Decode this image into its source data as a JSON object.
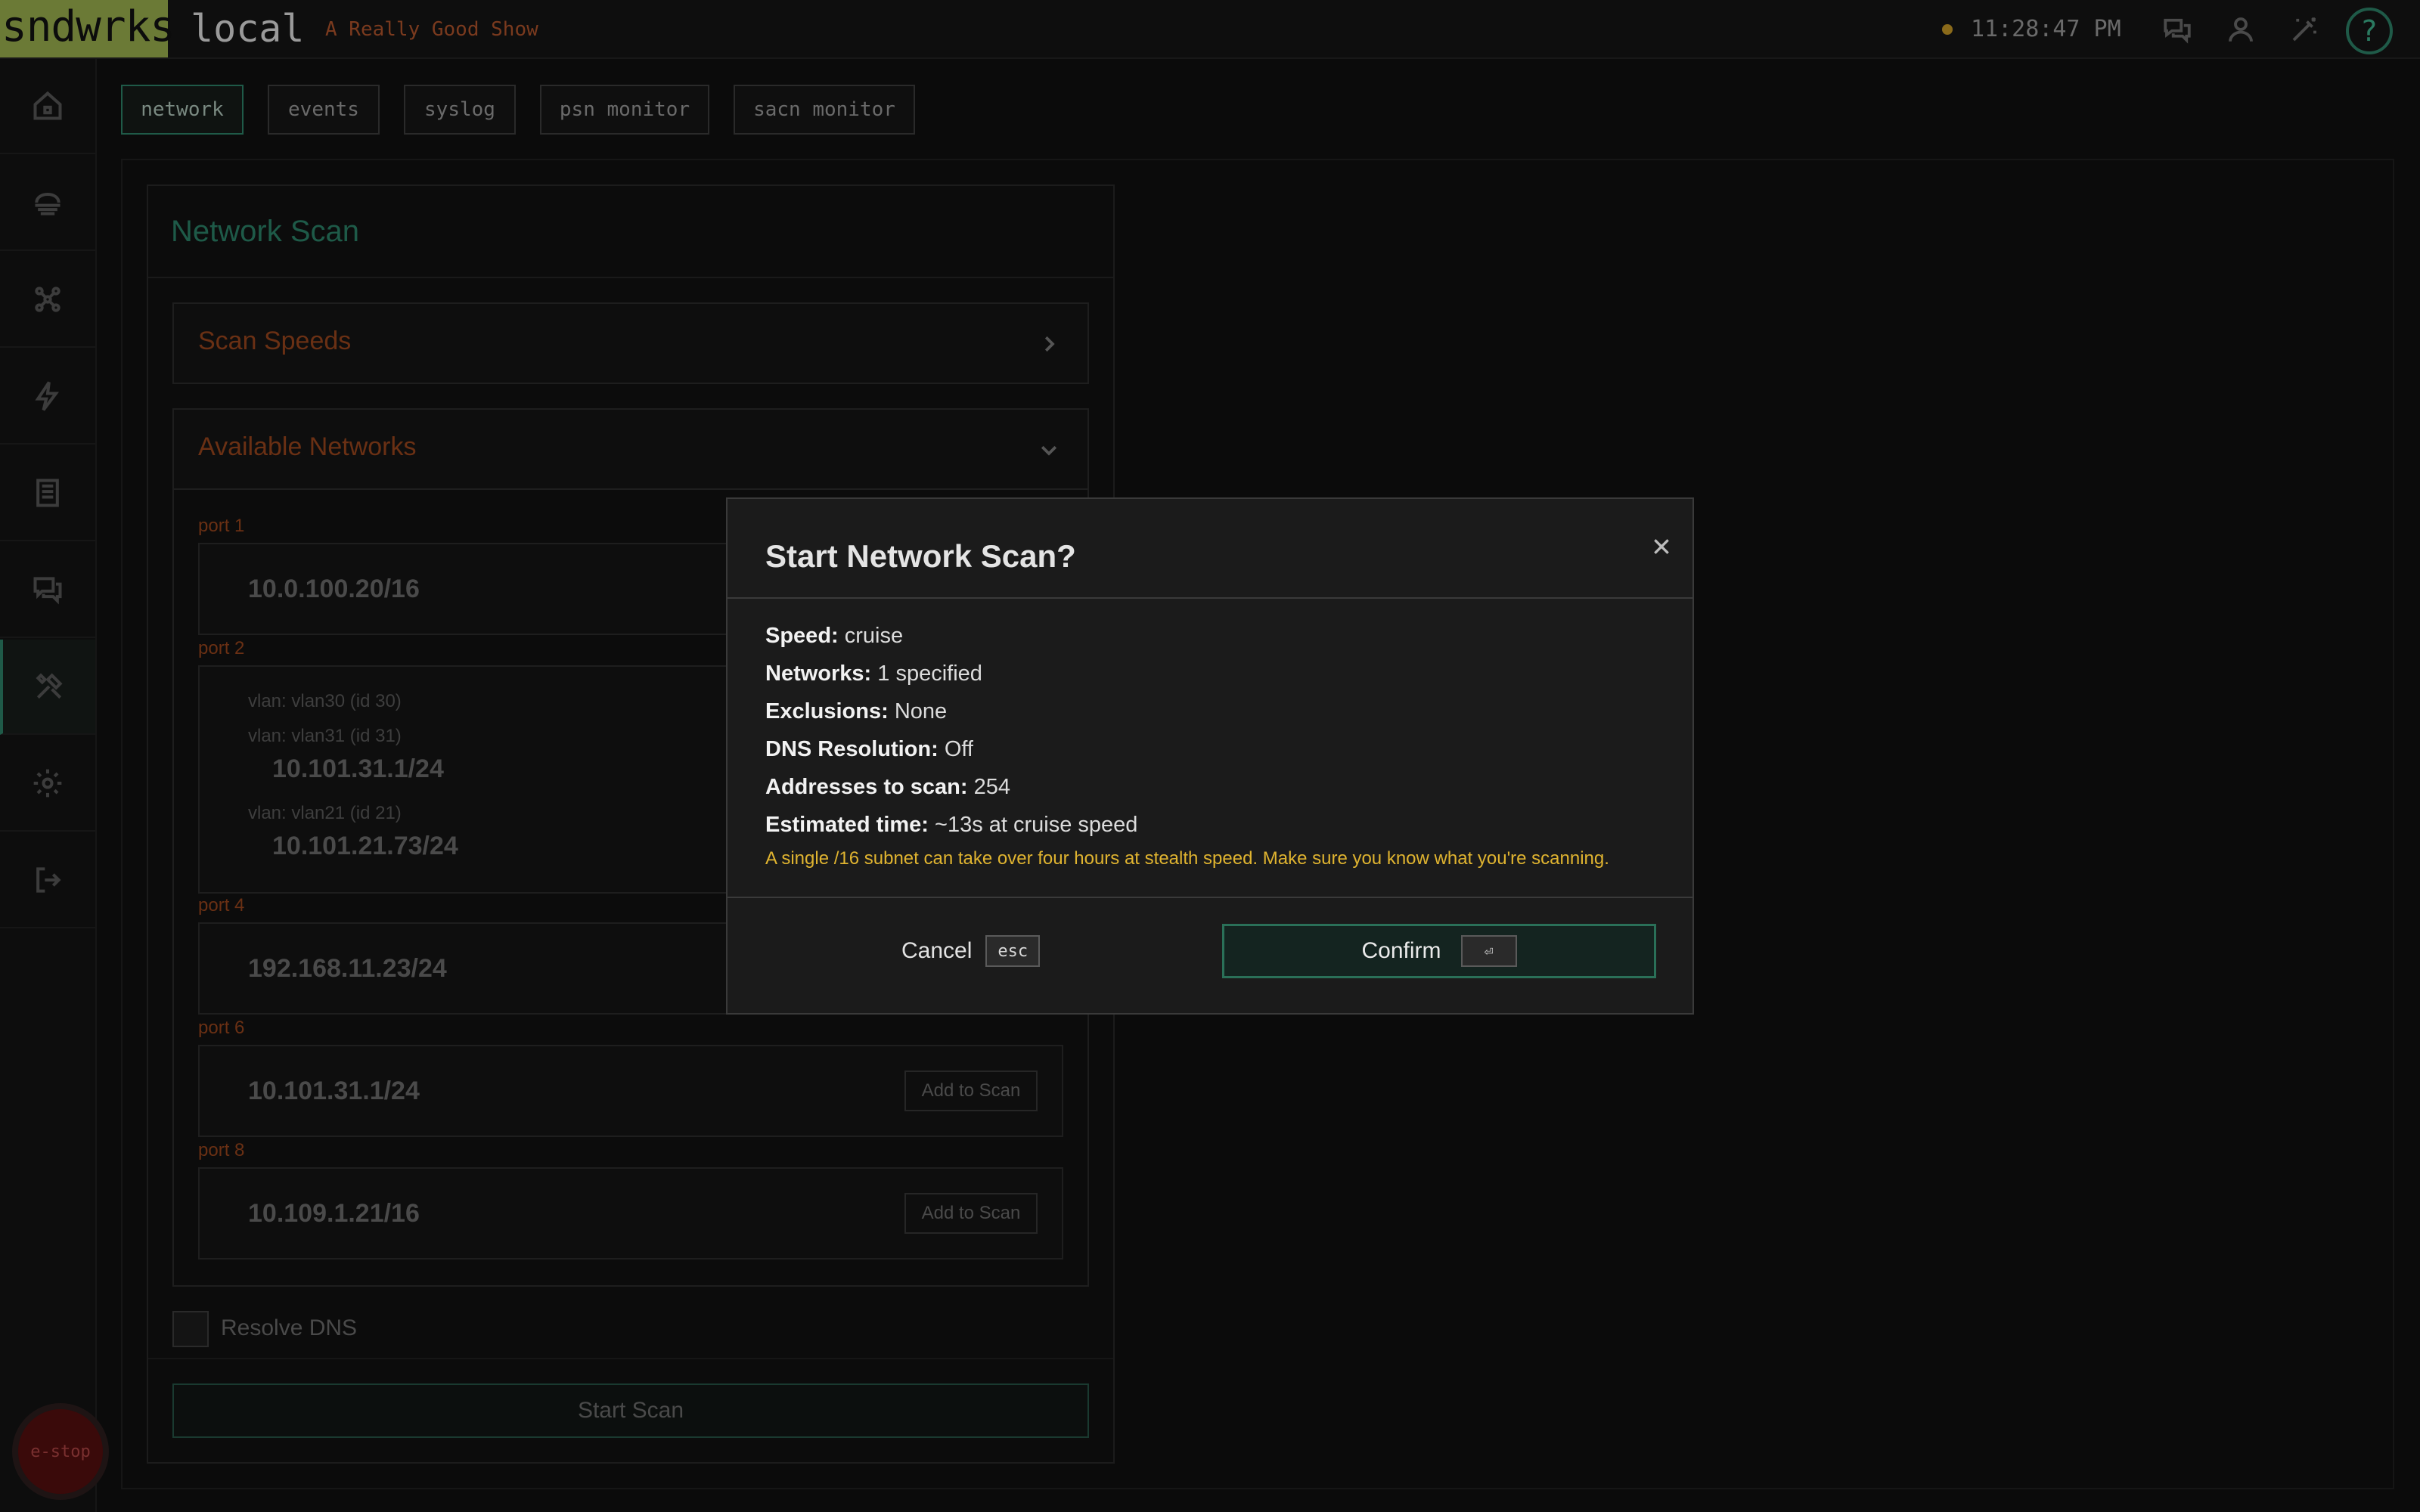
{
  "header": {
    "brand": "sndwrks",
    "host": "local",
    "show_name": "A Really Good Show",
    "clock": "11:28:47 PM",
    "help_glyph": "?",
    "icons": [
      "chat-icon",
      "user-icon",
      "magic-wand-icon",
      "help-icon"
    ]
  },
  "sidebar": {
    "items": [
      {
        "icon": "home-icon"
      },
      {
        "icon": "stage-icon"
      },
      {
        "icon": "network-nodes-icon"
      },
      {
        "icon": "lightning-icon"
      },
      {
        "icon": "document-icon"
      },
      {
        "icon": "messages-icon"
      },
      {
        "icon": "tools-icon",
        "active": true
      },
      {
        "icon": "gear-icon"
      },
      {
        "icon": "logout-icon"
      }
    ],
    "estop_label": "e-stop"
  },
  "tabs": [
    {
      "label": "network",
      "active": true
    },
    {
      "label": "events"
    },
    {
      "label": "syslog"
    },
    {
      "label": "psn monitor"
    },
    {
      "label": "sacn monitor"
    }
  ],
  "panel": {
    "title": "Network Scan",
    "scan_speeds_title": "Scan Speeds",
    "available_networks_title": "Available Networks",
    "ports": [
      {
        "label": "port 1",
        "ip": "10.0.100.20/16"
      },
      {
        "label": "port 2",
        "vlans": [
          {
            "label": "vlan: vlan30 (id 30)",
            "ip": ""
          },
          {
            "label": "vlan: vlan31 (id 31)",
            "ip": "10.101.31.1/24"
          },
          {
            "label": "vlan: vlan21 (id 21)",
            "ip": "10.101.21.73/24"
          }
        ]
      },
      {
        "label": "port 4",
        "ip": "192.168.11.23/24"
      },
      {
        "label": "port 6",
        "ip": "10.101.31.1/24",
        "button": "Add to Scan"
      },
      {
        "label": "port 8",
        "ip": "10.109.1.21/16",
        "button": "Add to Scan"
      }
    ],
    "resolve_dns_label": "Resolve DNS",
    "resolve_dns_checked": false,
    "start_scan_label": "Start Scan"
  },
  "modal": {
    "title": "Start Network Scan?",
    "details": [
      {
        "label": "Speed:",
        "value": "cruise"
      },
      {
        "label": "Networks:",
        "value": "1 specified"
      },
      {
        "label": "Exclusions:",
        "value": "None"
      },
      {
        "label": "DNS Resolution:",
        "value": "Off"
      },
      {
        "label": "Addresses to scan:",
        "value": "254"
      },
      {
        "label": "Estimated time:",
        "value": "~13s at cruise speed"
      }
    ],
    "warning": "A single /16 subnet can take over four hours at stealth speed. Make sure you know what you're scanning.",
    "cancel_label": "Cancel",
    "cancel_key": "esc",
    "confirm_label": "Confirm",
    "confirm_key": "⏎"
  },
  "colors": {
    "brand_bg": "#6b7a36",
    "accent_green": "#1f5a48",
    "section_orange": "#6a3014",
    "warning_yellow": "#e0b430",
    "estop_red": "#3a0a0a"
  }
}
